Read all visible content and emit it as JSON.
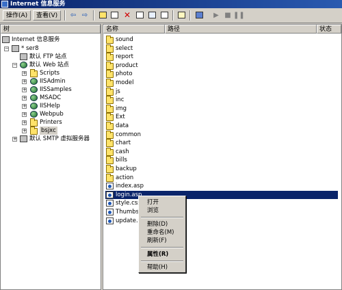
{
  "window": {
    "title": "Internet 信息服务"
  },
  "toolbar": {
    "menus": [
      {
        "label": "操作(A)"
      },
      {
        "label": "查看(V)"
      }
    ],
    "icons": [
      "back-icon",
      "forward-icon",
      "up-folder-icon",
      "show-tree-icon",
      "delete-icon",
      "properties-icon",
      "refresh-icon",
      "export-icon",
      "help-icon",
      "computer-icon",
      "start-icon",
      "stop-icon",
      "pause-icon"
    ]
  },
  "tree": {
    "header": "树",
    "root": "Internet 信息服务",
    "server": "* ser8",
    "ftp_site": "默认 FTP 站点",
    "web_site": "默认 Web 站点",
    "vdirs": [
      {
        "label": "Scripts"
      },
      {
        "label": "IISAdmin"
      },
      {
        "label": "IISSamples"
      },
      {
        "label": "MSADC"
      },
      {
        "label": "IISHelp"
      },
      {
        "label": "Webpub"
      },
      {
        "label": "Printers"
      },
      {
        "label": "bsjxc"
      }
    ],
    "smtp": "默认 SMTP 虚拟服务器"
  },
  "list": {
    "columns": [
      {
        "label": "名称"
      },
      {
        "label": "路径"
      },
      {
        "label": "状态"
      }
    ],
    "items": [
      {
        "name": "sound",
        "type": "folder"
      },
      {
        "name": "select",
        "type": "folder"
      },
      {
        "name": "report",
        "type": "folder"
      },
      {
        "name": "product",
        "type": "folder"
      },
      {
        "name": "photo",
        "type": "folder"
      },
      {
        "name": "model",
        "type": "folder"
      },
      {
        "name": "js",
        "type": "folder"
      },
      {
        "name": "inc",
        "type": "folder"
      },
      {
        "name": "img",
        "type": "folder"
      },
      {
        "name": "Ext",
        "type": "folder"
      },
      {
        "name": "data",
        "type": "folder"
      },
      {
        "name": "common",
        "type": "folder"
      },
      {
        "name": "chart",
        "type": "folder"
      },
      {
        "name": "cash",
        "type": "folder"
      },
      {
        "name": "bills",
        "type": "folder"
      },
      {
        "name": "backup",
        "type": "folder"
      },
      {
        "name": "action",
        "type": "folder"
      },
      {
        "name": "index.asp",
        "type": "file"
      },
      {
        "name": "login.asp",
        "type": "file"
      },
      {
        "name": "style.css",
        "type": "file"
      },
      {
        "name": "Thumbs.c",
        "type": "file"
      },
      {
        "name": "update.tx",
        "type": "file"
      }
    ],
    "selected": "login.asp"
  },
  "context_menu": {
    "items": [
      {
        "label": "打开"
      },
      {
        "label": "浏览"
      },
      {
        "label": "删除(D)"
      },
      {
        "label": "重命名(M)"
      },
      {
        "label": "刷新(F)"
      },
      {
        "label": "属性(R)"
      },
      {
        "label": "帮助(H)"
      }
    ]
  }
}
